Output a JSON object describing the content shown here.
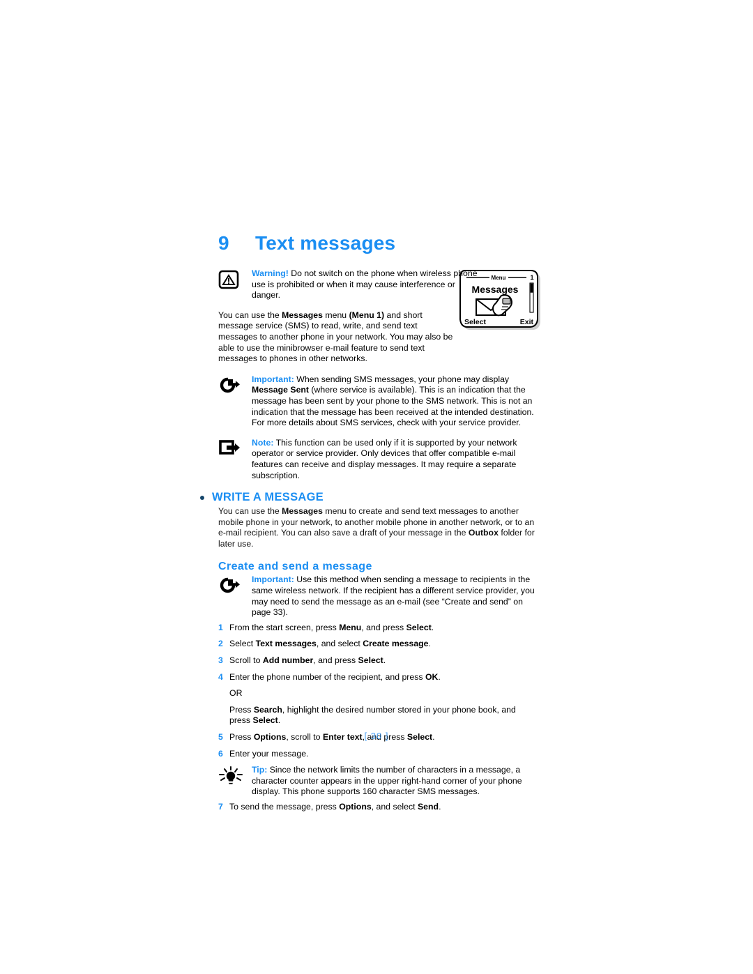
{
  "chapter": {
    "number": "9",
    "title": "Text messages"
  },
  "warning": {
    "icon": "warning-triangle-icon",
    "label": "Warning!",
    "text": " Do not switch on the phone when wireless phone use is prohibited or when it may cause interference or danger."
  },
  "intro": {
    "part1": "You can use the ",
    "bold1": "Messages",
    "part2": " menu ",
    "bold2": "(Menu 1)",
    "part3": " and short message service (SMS) to read, write, and send text messages to another phone in your network. You may also be able to use the minibrowser e-mail feature to send text messages to phones in other networks."
  },
  "phone_illustration": {
    "icon": "phone-screen-illustration",
    "menu_label": "Menu",
    "menu_number": "1",
    "screen_title": "Messages",
    "content_icon": "envelope-phone-icon",
    "softkey_left": "Select",
    "softkey_right": "Exit"
  },
  "important1": {
    "icon": "important-arrow-icon",
    "label": "Important:",
    "part1": " When sending SMS messages, your phone may display ",
    "bold1": "Message Sent",
    "part2": " (where service is available). This is an indication that the message has been sent by your phone to the SMS network. This is not an indication that the message has been received at the intended destination. For more details about SMS services, check with your service provider."
  },
  "note1": {
    "icon": "note-square-arrow-icon",
    "label": "Note:",
    "text": " This function can be used only if it is supported by your network operator or service provider. Only devices that offer compatible e-mail features can receive and display messages. It may require a separate subscription."
  },
  "section": {
    "bullet": "section-bullet-icon",
    "title": "WRITE A MESSAGE",
    "part1": "You can use the ",
    "bold1": "Messages",
    "part2": " menu to create and send text messages to another mobile phone in your network, to another mobile phone in another network, or to an e-mail recipient. You can also save a draft of your message in the ",
    "bold2": "Outbox",
    "part3": " folder for later use."
  },
  "subsection": {
    "title": "Create and send a message"
  },
  "important2": {
    "icon": "important-arrow-icon",
    "label": "Important:",
    "text": " Use this method when sending a message to recipients in the same wireless network. If the recipient has a different service provider, you may need to send the message as an e-mail (see “Create and send” on page 33)."
  },
  "steps": [
    {
      "num": "1",
      "segments": [
        {
          "t": "From the start screen, press ",
          "b": false
        },
        {
          "t": "Menu",
          "b": true
        },
        {
          "t": ", and press ",
          "b": false
        },
        {
          "t": "Select",
          "b": true
        },
        {
          "t": ".",
          "b": false
        }
      ]
    },
    {
      "num": "2",
      "segments": [
        {
          "t": "Select ",
          "b": false
        },
        {
          "t": "Text messages",
          "b": true
        },
        {
          "t": ", and select ",
          "b": false
        },
        {
          "t": "Create message",
          "b": true
        },
        {
          "t": ".",
          "b": false
        }
      ]
    },
    {
      "num": "3",
      "segments": [
        {
          "t": "Scroll to ",
          "b": false
        },
        {
          "t": "Add number",
          "b": true
        },
        {
          "t": ", and press ",
          "b": false
        },
        {
          "t": "Select",
          "b": true
        },
        {
          "t": ".",
          "b": false
        }
      ]
    },
    {
      "num": "4",
      "segments": [
        {
          "t": "Enter the phone number of the recipient, and press ",
          "b": false
        },
        {
          "t": "OK",
          "b": true
        },
        {
          "t": ".",
          "b": false
        }
      ]
    },
    {
      "num": "",
      "continuation": true,
      "segments": [
        {
          "t": "OR",
          "b": false
        }
      ]
    },
    {
      "num": "",
      "continuation": true,
      "segments": [
        {
          "t": "Press ",
          "b": false
        },
        {
          "t": "Search",
          "b": true
        },
        {
          "t": ", highlight the desired number stored in your phone book, and press ",
          "b": false
        },
        {
          "t": "Select",
          "b": true
        },
        {
          "t": ".",
          "b": false
        }
      ]
    },
    {
      "num": "5",
      "segments": [
        {
          "t": "Press ",
          "b": false
        },
        {
          "t": "Options",
          "b": true
        },
        {
          "t": ", scroll to ",
          "b": false
        },
        {
          "t": "Enter text",
          "b": true
        },
        {
          "t": ", and press ",
          "b": false
        },
        {
          "t": "Select",
          "b": true
        },
        {
          "t": ".",
          "b": false
        }
      ]
    },
    {
      "num": "6",
      "segments": [
        {
          "t": "Enter your message.",
          "b": false
        }
      ]
    }
  ],
  "tip": {
    "icon": "lightbulb-tip-icon",
    "label": "Tip:",
    "text": " Since the network limits the number of characters in a message, a character counter appears in the upper right-hand corner of your phone display. This phone supports 160 character SMS messages."
  },
  "final_step": {
    "num": "7",
    "segments": [
      {
        "t": "To send the message, press ",
        "b": false
      },
      {
        "t": "Options",
        "b": true
      },
      {
        "t": ", and select ",
        "b": false
      },
      {
        "t": "Send",
        "b": true
      },
      {
        "t": ".",
        "b": false
      }
    ]
  },
  "footer": {
    "page_number": "[ 30 ]"
  },
  "colors": {
    "accent_blue": "#1b8ef2",
    "footer_blue": "#4da2f5",
    "bullet_dark": "#15466b"
  }
}
